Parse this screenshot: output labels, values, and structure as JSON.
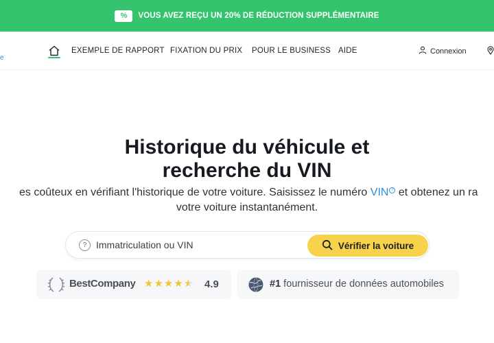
{
  "promo": {
    "icon": "percent-tag-icon",
    "text": "VOUS AVEZ REÇU UN 20% DE RÉDUCTION SUPPLÉMENTAIRE"
  },
  "nav": {
    "logo_fragment": "e",
    "home_icon": "home-icon",
    "links": [
      {
        "label": "EXEMPLE DE RAPPORT"
      },
      {
        "label": "FIXATION DU PRIX"
      },
      {
        "label": "POUR LE BUSINESS"
      },
      {
        "label": "AIDE"
      }
    ],
    "login": {
      "icon": "user-icon",
      "label": "Connexion"
    },
    "location_icon": "location-pin-icon"
  },
  "hero": {
    "title_line1": "Historique du véhicule et",
    "title_line2": "recherche du VIN",
    "subtitle_before": "es coûteux en vérifiant l'historique de votre voiture. Saisissez le numéro ",
    "subtitle_link": "VIN",
    "subtitle_info": "?",
    "subtitle_after": " et obtenez un ra",
    "subtitle_line2": "votre voiture instantanément."
  },
  "search": {
    "help_icon": "question-circle-icon",
    "help_glyph": "?",
    "placeholder": "Immatriculation ou VIN",
    "value": "",
    "button_label": "Vérifier la voiture",
    "button_icon": "search-icon"
  },
  "trust": {
    "bestcompany": {
      "icon": "laurel-icon",
      "name": "BestCompany",
      "stars": 4.5,
      "rating": "4.9"
    },
    "provider": {
      "icon": "globe-icon",
      "rank": "#1",
      "text": " fournisseur de données automobiles"
    }
  },
  "colors": {
    "accent_green": "#35c46e",
    "button_yellow": "#f8d24a",
    "link_blue": "#2a8fd8",
    "star_gold": "#f4c431"
  }
}
